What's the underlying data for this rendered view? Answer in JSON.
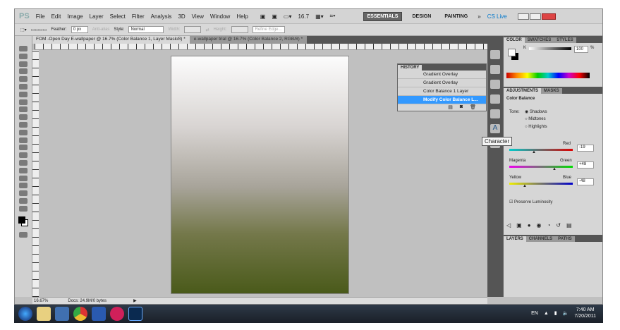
{
  "menu": {
    "logo": "PS",
    "items": [
      "File",
      "Edit",
      "Image",
      "Layer",
      "Select",
      "Filter",
      "Analysis",
      "3D",
      "View",
      "Window",
      "Help"
    ],
    "zoom": "16.7",
    "workspaces": [
      "ESSENTIALS",
      "DESIGN",
      "PAINTING"
    ],
    "more": "»",
    "cslive": "CS Live"
  },
  "options": {
    "feather_label": "Feather:",
    "feather_value": "0 px",
    "antialias": "Anti-alias",
    "style_label": "Style:",
    "style_value": "Normal",
    "width_label": "Width:",
    "height_label": "Height:",
    "refine": "Refine Edge..."
  },
  "tabs": [
    "FOM -Open Day E-wallpaper @ 16.7% (Color Balance 1, Layer Mask/8) *",
    "e-wallpaper trial @ 16.7% (Color Balance 2, RGB/8) *"
  ],
  "history": {
    "title": "HISTORY",
    "items": [
      "Gradient Overlay",
      "Gradient Overlay",
      "Color Balance 1 Layer",
      "Modify Color Balance L..."
    ],
    "selected": 3
  },
  "color": {
    "tabs": [
      "COLOR",
      "SWATCHES",
      "STYLES"
    ],
    "channel": "K",
    "value": "100",
    "unit": "%"
  },
  "adjustments": {
    "tabs": [
      "ADJUSTMENTS",
      "MASKS"
    ],
    "title": "Color Balance",
    "tone_label": "Tone:",
    "tones": [
      "Shadows",
      "Midtones",
      "Highlights"
    ],
    "selected_tone": "Shadows",
    "sliders": [
      {
        "left": "Cyan",
        "right": "Red",
        "value": "-19",
        "shown_left": ""
      },
      {
        "left": "Magenta",
        "right": "Green",
        "value": "+48"
      },
      {
        "left": "Yellow",
        "right": "Blue",
        "value": "-48"
      }
    ],
    "preserve": "Preserve Luminosity",
    "preserve_checked": true
  },
  "layers_tabs": [
    "LAYERS",
    "CHANNELS",
    "PATHS"
  ],
  "tooltip": "Character",
  "status": {
    "zoom": "16.67%",
    "docs": "Docs: 24.9M/0 bytes"
  },
  "taskbar": {
    "lang": "EN",
    "time": "7:40 AM",
    "date": "7/20/2011"
  }
}
